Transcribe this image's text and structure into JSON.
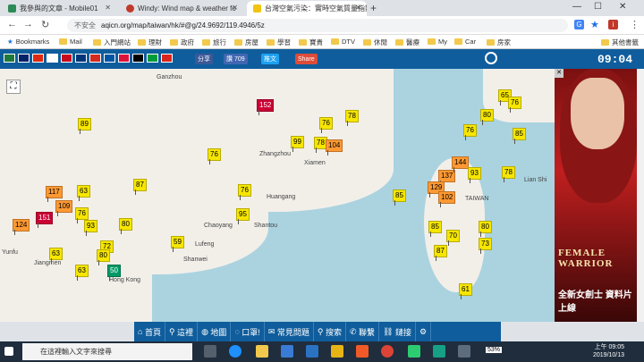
{
  "browser": {
    "tabs": [
      {
        "title": "我參與的文章 - Mobile01",
        "favcolor": "#2e8b57",
        "active": false
      },
      {
        "title": "Windy: Wind map & weather fo",
        "favcolor": "#c0392b",
        "active": false
      },
      {
        "title": "台灣空氣污染：實時空氣質量指數",
        "favcolor": "#f1c40f",
        "active": true
      }
    ],
    "new_tab": "+",
    "address": {
      "security": "不安全",
      "url": "aqicn.org/map/taiwan/hk/#@g/24.9692/119.4946/5z"
    },
    "bookmarks": [
      "Bookmarks",
      "Mail",
      "入門網站",
      "理財",
      "政府",
      "旅行",
      "房屋",
      "學習",
      "寶貴",
      "DTV",
      "休閒",
      "醫療",
      "My",
      "Car",
      "房家"
    ],
    "other_bookmarks": "其他書籤"
  },
  "site": {
    "share_buttons": [
      {
        "label": "分享",
        "color": "#3b5998"
      },
      {
        "label": "讚 709",
        "color": "#4267b2"
      },
      {
        "label": "推文",
        "color": "#1da1f2"
      },
      {
        "label": "Share",
        "color": "#dd4b39"
      }
    ],
    "clock": "09:04"
  },
  "map": {
    "markers": [
      {
        "v": "89",
        "c": "#f6e600"
      },
      {
        "v": "152",
        "c": "#cc0033"
      },
      {
        "v": "76",
        "c": "#f6e600"
      },
      {
        "v": "78",
        "c": "#f6e600"
      },
      {
        "v": "99",
        "c": "#f6e600"
      },
      {
        "v": "78",
        "c": "#f6e600"
      },
      {
        "v": "104",
        "c": "#ff9933"
      },
      {
        "v": "76",
        "c": "#f6e600"
      },
      {
        "v": "87",
        "c": "#f6e600"
      },
      {
        "v": "63",
        "c": "#f6e600"
      },
      {
        "v": "117",
        "c": "#ff9933"
      },
      {
        "v": "109",
        "c": "#ff9933"
      },
      {
        "v": "151",
        "c": "#cc0033"
      },
      {
        "v": "124",
        "c": "#ff9933"
      },
      {
        "v": "76",
        "c": "#f6e600"
      },
      {
        "v": "93",
        "c": "#f6e600"
      },
      {
        "v": "80",
        "c": "#f6e600"
      },
      {
        "v": "59",
        "c": "#f6e600"
      },
      {
        "v": "72",
        "c": "#f6e600"
      },
      {
        "v": "63",
        "c": "#f6e600"
      },
      {
        "v": "80",
        "c": "#f6e600"
      },
      {
        "v": "63",
        "c": "#f6e600"
      },
      {
        "v": "50",
        "c": "#009966"
      },
      {
        "v": "76",
        "c": "#f6e600"
      },
      {
        "v": "95",
        "c": "#f6e600"
      },
      {
        "v": "85",
        "c": "#f6e600"
      },
      {
        "v": "137",
        "c": "#ff9933"
      },
      {
        "v": "144",
        "c": "#ff9933"
      },
      {
        "v": "129",
        "c": "#ff9933"
      },
      {
        "v": "102",
        "c": "#ff9933"
      },
      {
        "v": "93",
        "c": "#f6e600"
      },
      {
        "v": "78",
        "c": "#f6e600"
      },
      {
        "v": "85",
        "c": "#f6e600"
      },
      {
        "v": "80",
        "c": "#f6e600"
      },
      {
        "v": "73",
        "c": "#f6e600"
      },
      {
        "v": "70",
        "c": "#f6e600"
      },
      {
        "v": "87",
        "c": "#f6e600"
      },
      {
        "v": "61",
        "c": "#f6e600"
      },
      {
        "v": "65",
        "c": "#f6e600"
      },
      {
        "v": "76",
        "c": "#f6e600"
      },
      {
        "v": "80",
        "c": "#f6e600"
      },
      {
        "v": "85",
        "c": "#f6e600"
      },
      {
        "v": "76",
        "c": "#f6e600"
      }
    ],
    "places": [
      "Ganzhou",
      "Zhangzhou",
      "Xiamen",
      "Huangang",
      "Chaoyang",
      "Shantou",
      "Shanwei",
      "Lufeng",
      "Hong Kong",
      "Lian Shi",
      "TAIWAN",
      "Yunfu",
      "Jiangmen"
    ]
  },
  "ad": {
    "title": "FEMALE WARRIOR",
    "subtitle": "全新女劍士 資料片上線"
  },
  "bottom_nav": [
    "首頁",
    "這裡",
    "地圖",
    "口罩!",
    "常見問題",
    "搜索",
    "聯繫",
    "鏈接"
  ],
  "taskbar": {
    "search_placeholder": "在這裡輸入文字來搜尋",
    "battery": "53%",
    "time": "上午 09:05",
    "date": "2019/10/13"
  }
}
